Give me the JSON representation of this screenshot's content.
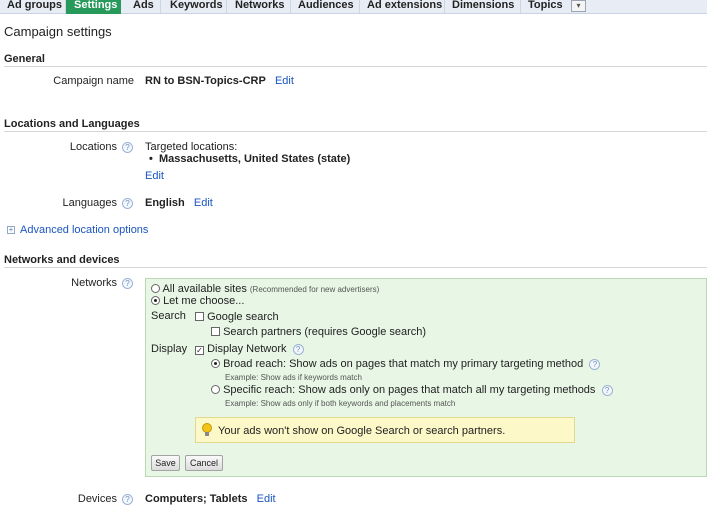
{
  "tabs": [
    "Ad groups",
    "Settings",
    "Ads",
    "Keywords",
    "Networks",
    "Audiences",
    "Ad extensions",
    "Dimensions",
    "Topics"
  ],
  "active_tab": "Settings",
  "more_glyph": "▾",
  "page_title": "Campaign settings",
  "general": {
    "heading": "General",
    "campaign_name_label": "Campaign name",
    "campaign_name": "RN to BSN-Topics-CRP",
    "edit": "Edit"
  },
  "locations": {
    "heading": "Locations and Languages",
    "locations_label": "Locations",
    "targeted_label": "Targeted locations:",
    "targeted_item": "Massachusetts, United States (state)",
    "bullet": "•",
    "edit": "Edit",
    "languages_label": "Languages",
    "language": "English",
    "languages_edit": "Edit",
    "advanced_link": "Advanced location options",
    "expand_glyph": "+"
  },
  "networks": {
    "heading": "Networks and devices",
    "networks_label": "Networks",
    "all_sites": "All available sites",
    "all_sites_note": "(Recommended for new advertisers)",
    "let_me_choose": "Let me choose...",
    "search_label": "Search",
    "google_search": "Google search",
    "search_partners": "Search partners (requires Google search)",
    "display_label": "Display",
    "display_network": "Display Network",
    "broad_reach": "Broad reach: Show ads on pages that match my primary targeting method",
    "broad_example": "Example: Show ads if keywords match",
    "specific_reach": "Specific reach: Show ads only on pages that match all my targeting methods",
    "specific_example": "Example: Show ads only if both keywords and placements match",
    "warning": "Your ads won't show on Google Search or search partners.",
    "save": "Save",
    "cancel": "Cancel",
    "check_glyph": "✓"
  },
  "devices": {
    "label": "Devices",
    "value": "Computers; Tablets",
    "edit": "Edit"
  },
  "help_glyph": "?",
  "colors": {
    "active_tab": "#27995a",
    "link": "#1a55c2",
    "network_panel": "#e8f7e5",
    "warning_bg": "#fcf8c8"
  }
}
